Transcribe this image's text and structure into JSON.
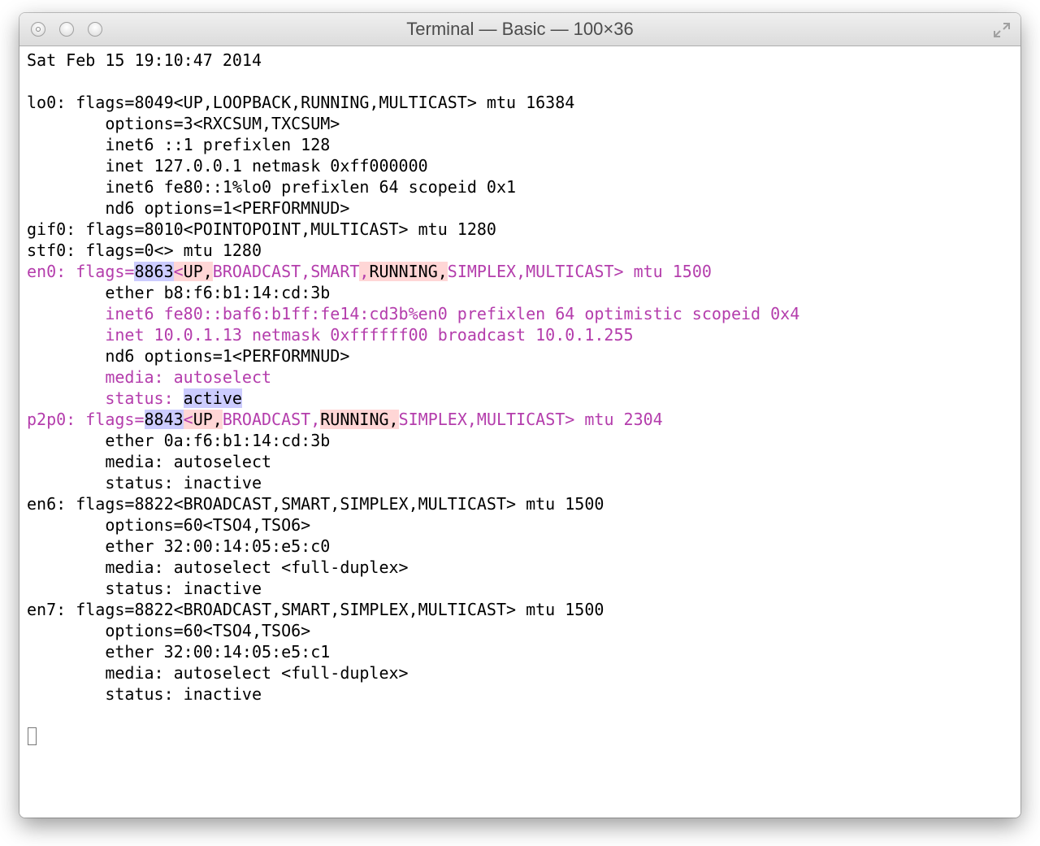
{
  "window": {
    "title": "Terminal — Basic — 100×36"
  },
  "terminal": {
    "lines": [
      [
        {
          "t": "Sat Feb 15 19:10:47 2014",
          "s": ""
        }
      ],
      [
        {
          "t": "",
          "s": ""
        }
      ],
      [
        {
          "t": "lo0: flags=8049<UP,LOOPBACK,RUNNING,MULTICAST> mtu 16384",
          "s": ""
        }
      ],
      [
        {
          "t": "        options=3<RXCSUM,TXCSUM>",
          "s": ""
        }
      ],
      [
        {
          "t": "        inet6 ::1 prefixlen 128",
          "s": ""
        }
      ],
      [
        {
          "t": "        inet 127.0.0.1 netmask 0xff000000",
          "s": ""
        }
      ],
      [
        {
          "t": "        inet6 fe80::1%lo0 prefixlen 64 scopeid 0x1",
          "s": ""
        }
      ],
      [
        {
          "t": "        nd6 options=1<PERFORMNUD>",
          "s": ""
        }
      ],
      [
        {
          "t": "gif0: flags=8010<POINTOPOINT,MULTICAST> mtu 1280",
          "s": ""
        }
      ],
      [
        {
          "t": "stf0: flags=0<> mtu 1280",
          "s": ""
        }
      ],
      [
        {
          "t": "en0: flags=",
          "s": "mag"
        },
        {
          "t": "8863",
          "s": "bs"
        },
        {
          "t": "<",
          "s": "pk"
        },
        {
          "t": "UP,",
          "s": "bk"
        },
        {
          "t": "BROADCAST,SMART",
          "s": "mag"
        },
        {
          "t": ",",
          "s": "pk"
        },
        {
          "t": "RUNNING,",
          "s": "bk"
        },
        {
          "t": "SIMPLEX,MULTICAST> mtu 1500",
          "s": "mag"
        }
      ],
      [
        {
          "t": "        ether b8:f6:b1:14:cd:3b",
          "s": ""
        }
      ],
      [
        {
          "t": "        inet6 fe80::baf6:b1ff:fe14:cd3b%en0 prefixlen 64 optimistic scopeid 0x4",
          "s": "mag"
        }
      ],
      [
        {
          "t": "        inet 10.0.1.13 netmask 0xffffff00 broadcast 10.0.1.255",
          "s": "mag"
        }
      ],
      [
        {
          "t": "        nd6 options=1<PERFORMNUD>",
          "s": ""
        }
      ],
      [
        {
          "t": "        media: autoselect",
          "s": "mag"
        }
      ],
      [
        {
          "t": "        status: ",
          "s": "mag"
        },
        {
          "t": "active",
          "s": "bs"
        }
      ],
      [
        {
          "t": "p2p0: flags=",
          "s": "mag"
        },
        {
          "t": "8843",
          "s": "bs"
        },
        {
          "t": "<",
          "s": "pk"
        },
        {
          "t": "UP,",
          "s": "bk"
        },
        {
          "t": "BROADCAST,",
          "s": "mag"
        },
        {
          "t": "RUNNING,",
          "s": "bk"
        },
        {
          "t": "SIMPLEX,MULTICAST> mtu 2304",
          "s": "mag"
        }
      ],
      [
        {
          "t": "        ether 0a:f6:b1:14:cd:3b",
          "s": ""
        }
      ],
      [
        {
          "t": "        media: autoselect",
          "s": ""
        }
      ],
      [
        {
          "t": "        status: inactive",
          "s": ""
        }
      ],
      [
        {
          "t": "en6: flags=8822<BROADCAST,SMART,SIMPLEX,MULTICAST> mtu 1500",
          "s": ""
        }
      ],
      [
        {
          "t": "        options=60<TSO4,TSO6>",
          "s": ""
        }
      ],
      [
        {
          "t": "        ether 32:00:14:05:e5:c0",
          "s": ""
        }
      ],
      [
        {
          "t": "        media: autoselect <full-duplex>",
          "s": ""
        }
      ],
      [
        {
          "t": "        status: inactive",
          "s": ""
        }
      ],
      [
        {
          "t": "en7: flags=8822<BROADCAST,SMART,SIMPLEX,MULTICAST> mtu 1500",
          "s": ""
        }
      ],
      [
        {
          "t": "        options=60<TSO4,TSO6>",
          "s": ""
        }
      ],
      [
        {
          "t": "        ether 32:00:14:05:e5:c1",
          "s": ""
        }
      ],
      [
        {
          "t": "        media: autoselect <full-duplex>",
          "s": ""
        }
      ],
      [
        {
          "t": "        status: inactive",
          "s": ""
        }
      ]
    ]
  },
  "colors": {
    "highlight_text": "#b43dac",
    "selection_blue": "#ccccff",
    "selection_pink": "#ffd6d6"
  },
  "icons": {
    "close": "close-icon",
    "minimize": "minimize-icon",
    "zoom": "zoom-icon",
    "fullscreen": "fullscreen-icon",
    "cursor": "block-cursor"
  }
}
